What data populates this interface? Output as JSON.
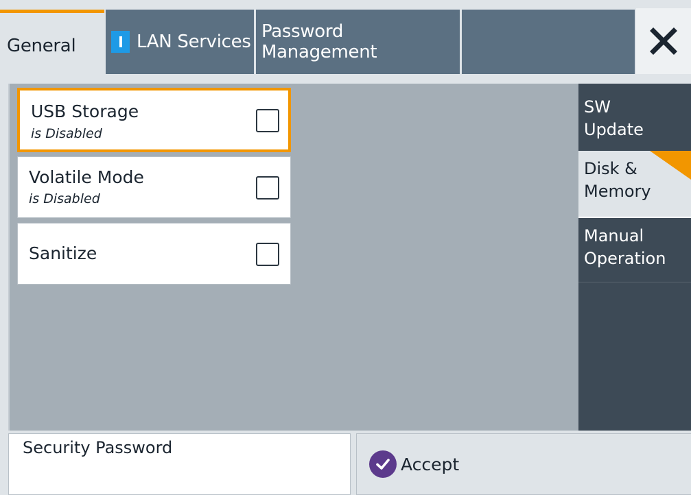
{
  "tabs": {
    "general": "General",
    "lan_services": "LAN Services",
    "password_management": "Password Management"
  },
  "close_icon": "close-icon",
  "options": [
    {
      "label": "USB Storage",
      "status": "is Disabled",
      "checked": false,
      "selected": true
    },
    {
      "label": "Volatile Mode",
      "status": "is Disabled",
      "checked": false,
      "selected": false
    },
    {
      "label": "Sanitize",
      "checked": false,
      "selected": false
    }
  ],
  "side_tabs": {
    "sw_update": {
      "line1": "SW",
      "line2": "Update"
    },
    "disk_memory": {
      "line1": "Disk &",
      "line2": "Memory"
    },
    "manual_operation": {
      "line1": "Manual",
      "line2": "Operation"
    }
  },
  "security_password": {
    "label": "Security Password"
  },
  "accept": {
    "label": "Accept"
  },
  "colors": {
    "accent": "#f29600",
    "tab_dark": "#5b7082",
    "side_dark": "#3d4a56",
    "panel": "#a4aeb6",
    "info": "#1e9ae6",
    "accept_icon": "#5c3a8c"
  }
}
